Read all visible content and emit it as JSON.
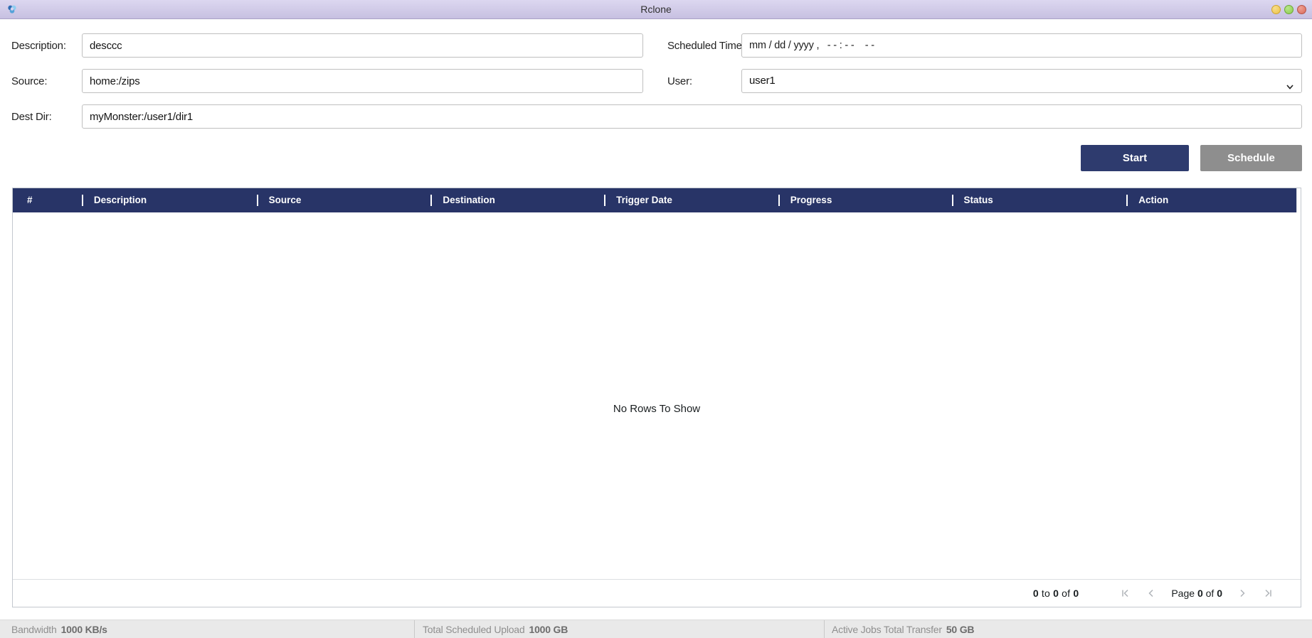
{
  "titlebar": {
    "title": "Rclone"
  },
  "form": {
    "description": {
      "label": "Description:",
      "value": "desccc"
    },
    "scheduled_time": {
      "label": "Scheduled Time:",
      "value": "mm / dd / yyyy ,   - - : - -    - -"
    },
    "source": {
      "label": "Source:",
      "value": "home:/zips"
    },
    "user": {
      "label": "User:",
      "value": "user1"
    },
    "dest_dir": {
      "label": "Dest Dir:",
      "value": "myMonster:/user1/dir1"
    }
  },
  "buttons": {
    "start": "Start",
    "schedule": "Schedule"
  },
  "table": {
    "columns": [
      "#",
      "Description",
      "Source",
      "Destination",
      "Trigger Date",
      "Progress",
      "Status",
      "Action"
    ],
    "empty_message": "No Rows To Show",
    "rows": []
  },
  "pagination": {
    "summary": {
      "start": "0",
      "to": "to",
      "end": "0",
      "of": "of",
      "total": "0"
    },
    "page": {
      "label": "Page",
      "current": "0",
      "of": "of",
      "total": "0"
    }
  },
  "status_bar": {
    "sections": [
      {
        "label": "Bandwidth",
        "value": "1000 KB/s"
      },
      {
        "label": "Total Scheduled Upload",
        "value": "1000 GB"
      },
      {
        "label": "Active Jobs Total Transfer",
        "value": "50 GB"
      }
    ]
  },
  "colors": {
    "titlebar": "#cfc8e6",
    "header_navy": "#283467",
    "start_navy": "#2e3b6e",
    "schedule_gray": "#8e8e8e",
    "statusbar_gray": "#e9e9e9"
  }
}
